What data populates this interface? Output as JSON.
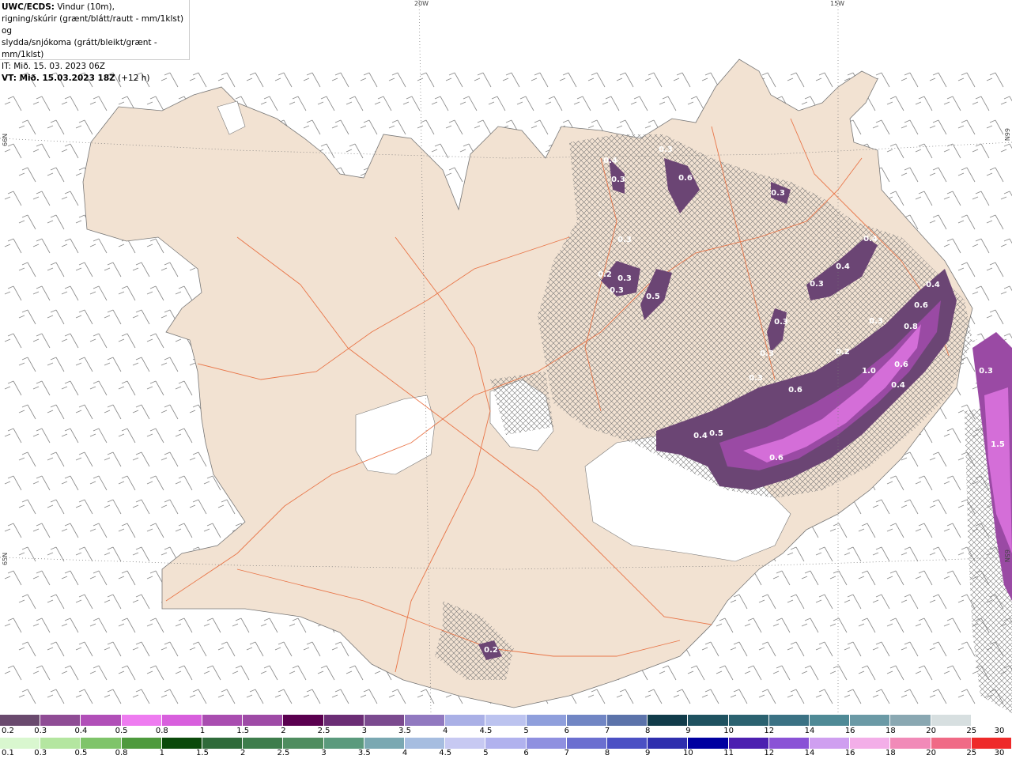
{
  "info": {
    "line1_bold": "UWC/ECDS:",
    "line1": " Vindur (10m),",
    "line2": "rigning/skúrir (grænt/blátt/rautt - mm/1klst) og",
    "line3": "slydda/snjókoma (grátt/bleikt/grænt - mm/1klst)",
    "line4": "IT: Mið. 15. 03. 2023 06Z",
    "line5_bold": "VT: Mið. 15.03.2023 18Z",
    "line5": " (+12 h)"
  },
  "grid_labels": {
    "lon_20w": "20W",
    "lon_15w": "15W",
    "lat_66n_left": "66N",
    "lat_66n_right": "66N",
    "lat_65n_left": "65N",
    "lat_65n_right": "65N"
  },
  "precip_values": [
    "0.4",
    "0.3",
    "0.3",
    "0.6",
    "0.3",
    "0.3",
    "0.2",
    "0.3",
    "0.3",
    "0.5",
    "0.4",
    "0.4",
    "0.3",
    "0.3",
    "0.3",
    "0.4",
    "0.6",
    "0.3",
    "0.8",
    "0.2",
    "1.0",
    "0.6",
    "0.4",
    "0.3",
    "0.6",
    "0.4",
    "0.5",
    "0.6",
    "0.3",
    "0.3",
    "1.5",
    "0.2"
  ],
  "legend_snow": {
    "colors": [
      "#6a4a6e",
      "#8f4c95",
      "#b14fb8",
      "#ee7cf0",
      "#d85fdd",
      "#a94db0",
      "#9e4aa6",
      "#5a004f",
      "#6b2d75",
      "#7b4a8f",
      "#9179c0",
      "#aab0e6",
      "#bcc3ef",
      "#8f9fdc",
      "#7186c4",
      "#5c73aa",
      "#113c4a",
      "#1f5260",
      "#2b6270",
      "#3b7284",
      "#4f8a96",
      "#6b9aa6",
      "#8aa8b2",
      "#d7dfe0",
      "#ffffff"
    ],
    "labels": [
      "0.2",
      "0.3",
      "0.4",
      "0.5",
      "0.8",
      "1",
      "1.5",
      "2",
      "2.5",
      "3",
      "3.5",
      "4",
      "4.5",
      "5",
      "6",
      "7",
      "8",
      "9",
      "10",
      "12",
      "14",
      "16",
      "18",
      "20",
      "25",
      "30"
    ]
  },
  "legend_rain": {
    "colors": [
      "#d9f7cf",
      "#b4e6a0",
      "#7fc46a",
      "#4e9a3d",
      "#0b4a0b",
      "#2f6b3a",
      "#3e7d4c",
      "#4f8d5f",
      "#5b9a7d",
      "#7aa8b2",
      "#a6bde0",
      "#c7c9f2",
      "#b1b2ee",
      "#8f90e0",
      "#6b6fd0",
      "#4b50c4",
      "#2f2fae",
      "#0000a0",
      "#4c1fb0",
      "#8a52d6",
      "#cf9ff0",
      "#f3aee8",
      "#f18ab8",
      "#f06a86",
      "#ee2a2a"
    ],
    "labels": [
      "0.1",
      "0.3",
      "0.5",
      "0.8",
      "1",
      "1.5",
      "2",
      "2.5",
      "3",
      "3.5",
      "4",
      "4.5",
      "5",
      "6",
      "7",
      "8",
      "9",
      "10",
      "11",
      "12",
      "14",
      "16",
      "18",
      "20",
      "25",
      "30"
    ]
  }
}
